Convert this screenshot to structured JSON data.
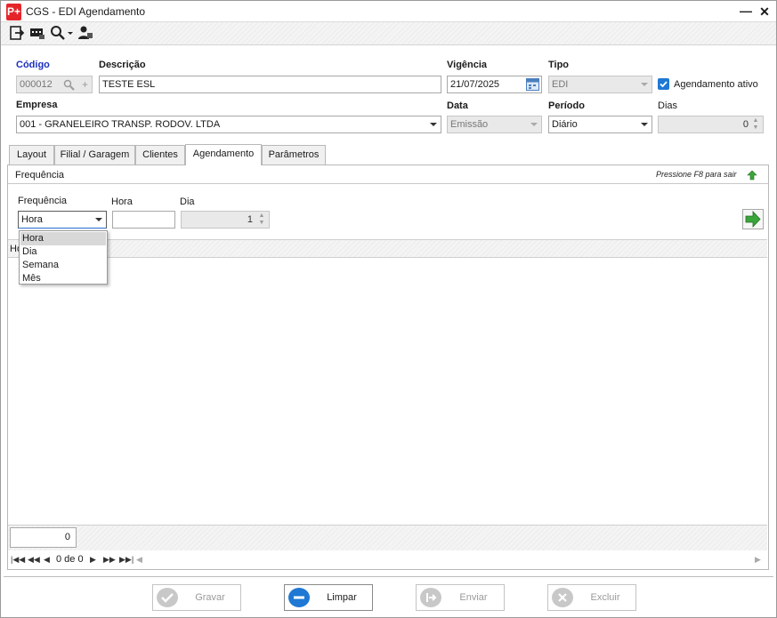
{
  "window": {
    "title": "CGS - EDI Agendamento",
    "logo_text": "P+"
  },
  "titlebar": {
    "minimize": "—",
    "close": "✕"
  },
  "toolbar": {
    "icons": [
      "exit-icon",
      "message-icon",
      "search-icon",
      "user-icon"
    ]
  },
  "form": {
    "codigo": {
      "label": "Código",
      "value": "000012"
    },
    "descricao": {
      "label": "Descrição",
      "value": "TESTE ESL"
    },
    "vigencia": {
      "label": "Vigência",
      "value": "21/07/2025"
    },
    "tipo": {
      "label": "Tipo",
      "value": "EDI"
    },
    "agendamento_ativo": {
      "label": "Agendamento ativo",
      "checked": true
    },
    "empresa": {
      "label": "Empresa",
      "value": "001 - GRANELEIRO TRANSP. RODOV. LTDA"
    },
    "data": {
      "label": "Data",
      "value": "Emissão"
    },
    "periodo": {
      "label": "Período",
      "value": "Diário"
    },
    "dias": {
      "label": "Dias",
      "value": "0"
    }
  },
  "tabs": [
    {
      "label": "Layout"
    },
    {
      "label": "Filial / Garagem"
    },
    {
      "label": "Clientes"
    },
    {
      "label": "Agendamento",
      "active": true
    },
    {
      "label": "Parâmetros"
    }
  ],
  "panel": {
    "section_title": "Frequência",
    "hint": "Pressione F8 para sair",
    "frequencia": {
      "label": "Frequência",
      "value": "Hora",
      "options": [
        "Hora",
        "Dia",
        "Semana",
        "Mês"
      ],
      "highlighted": "Hora"
    },
    "hora": {
      "label": "Hora",
      "value": ""
    },
    "dia": {
      "label": "Dia",
      "value": "1"
    },
    "grid_header_partial": "Ho",
    "total": "0",
    "pager": {
      "text": "0 de 0"
    }
  },
  "buttons": {
    "gravar": "Gravar",
    "limpar": "Limpar",
    "enviar": "Enviar",
    "excluir": "Excluir"
  },
  "colors": {
    "accent_blue": "#1c2fbd",
    "logo_red": "#e4262b",
    "arrow_green": "#3aa63a",
    "limpar_blue": "#1e78d4"
  }
}
